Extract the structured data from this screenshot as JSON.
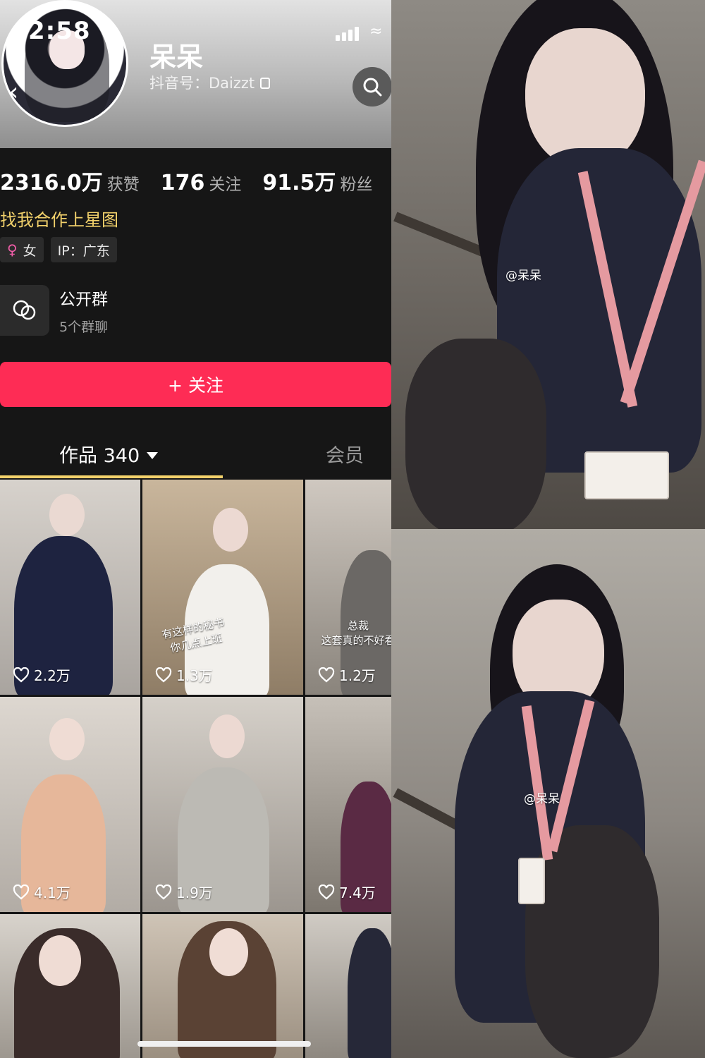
{
  "status_bar": {
    "time": "2:58"
  },
  "profile": {
    "nickname": "呆呆",
    "account_id": "抖音号：Daizzt"
  },
  "stats": [
    {
      "value": "2316.0万",
      "label": "获赞"
    },
    {
      "value": "176",
      "label": "关注"
    },
    {
      "value": "91.5万",
      "label": "粉丝"
    }
  ],
  "bio": "找我合作上星图",
  "tags": {
    "gender": "女",
    "ip": "IP：广东"
  },
  "group": {
    "title": "公开群",
    "subtitle": "5个群聊"
  },
  "follow_button": "+ 关注",
  "tabs": {
    "works": "作品 340",
    "member": "会员"
  },
  "videos": [
    {
      "likes": "2.2万",
      "caption": ""
    },
    {
      "likes": "1.3万",
      "caption": "有这样的秘书\n你几点上班"
    },
    {
      "likes": "1.2万",
      "caption": "总裁\n这套真的不好看"
    },
    {
      "likes": "4.1万",
      "caption": ""
    },
    {
      "likes": "1.9万",
      "caption": ""
    },
    {
      "likes": "7.4万",
      "caption": ""
    }
  ],
  "photos": {
    "watermark_top": "@呆呆",
    "watermark_bottom": "@呆呆"
  },
  "colors": {
    "accent": "#fe2c55",
    "bio": "#f2d16b",
    "background": "#161616"
  }
}
